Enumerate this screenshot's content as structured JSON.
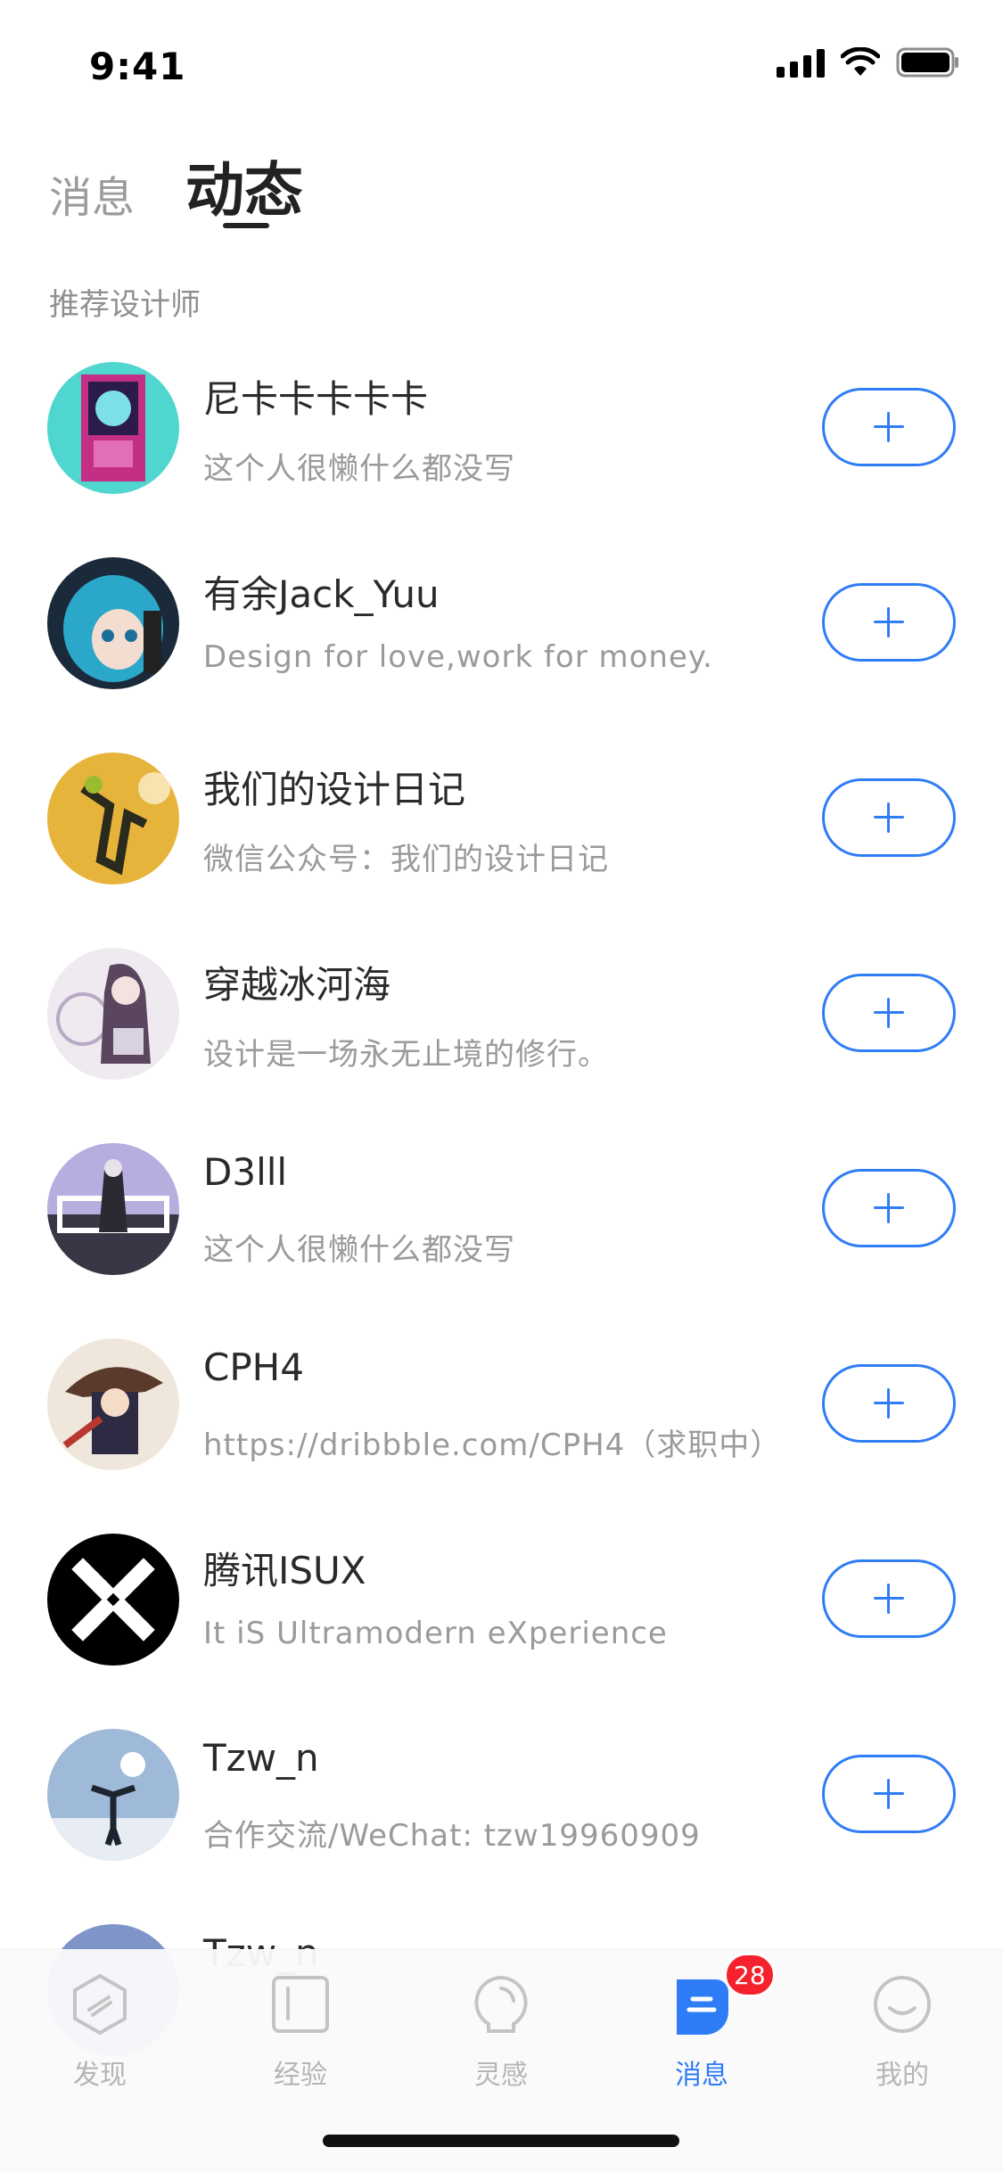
{
  "status_bar": {
    "time": "9:41"
  },
  "header": {
    "tab_inactive": "消息",
    "tab_active": "动态"
  },
  "section_title": "推荐设计师",
  "designers": [
    {
      "name": "尼卡卡卡卡卡",
      "desc": "这个人很懒什么都没写"
    },
    {
      "name": "有余Jack_Yuu",
      "desc": "Design for love,work for money."
    },
    {
      "name": "我们的设计日记",
      "desc": "微信公众号：我们的设计日记"
    },
    {
      "name": "穿越冰河海",
      "desc": "设计是一场永无止境的修行。"
    },
    {
      "name": "D3lll",
      "desc": "这个人很懒什么都没写"
    },
    {
      "name": "CPH4",
      "desc": "https://dribbble.com/CPH4（求职中）"
    },
    {
      "name": "腾讯ISUX",
      "desc": "It iS Ultramodern eXperience"
    },
    {
      "name": "Tzw_n",
      "desc": "合作交流/WeChat: tzw19960909"
    },
    {
      "name": "Tzw_n",
      "desc": ""
    }
  ],
  "tabbar": {
    "items": [
      {
        "label": "发现",
        "icon": "discover-icon"
      },
      {
        "label": "经验",
        "icon": "experience-icon"
      },
      {
        "label": "灵感",
        "icon": "inspiration-icon"
      },
      {
        "label": "消息",
        "icon": "message-icon"
      },
      {
        "label": "我的",
        "icon": "profile-icon"
      }
    ],
    "active_index": 3,
    "badge_count": "28"
  },
  "colors": {
    "accent": "#2f7df6",
    "badge": "#f5222d"
  }
}
